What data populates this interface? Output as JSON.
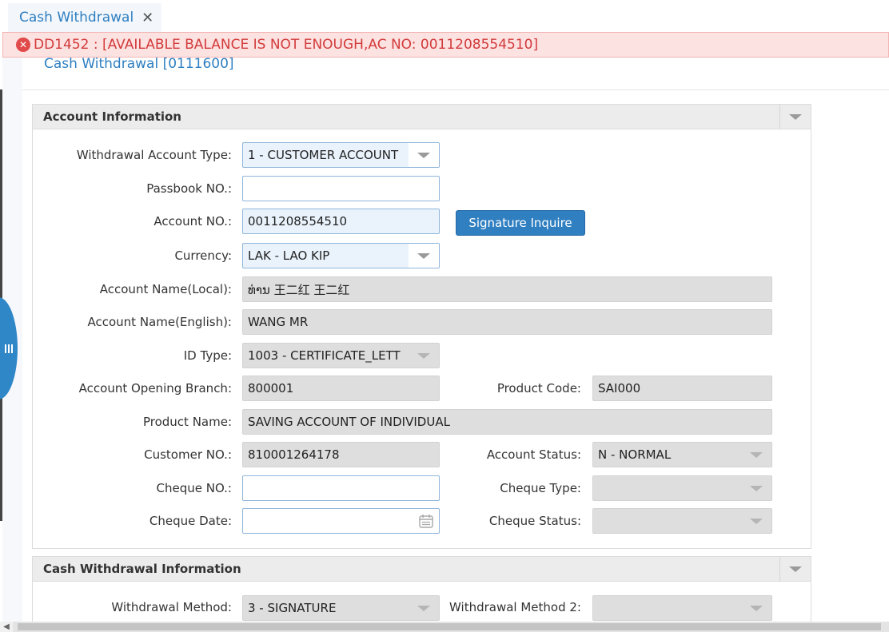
{
  "tab": {
    "label": "Cash Withdrawal",
    "close": "✕"
  },
  "error": {
    "icon": "error-circle-icon",
    "text": "DD1452 : [AVAILABLE BALANCE IS NOT ENOUGH,AC NO: 0011208554510]"
  },
  "page_title": "Cash Withdrawal [0111600]",
  "account_panel": {
    "title": "Account Information",
    "withdrawal_account_type": {
      "label": "Withdrawal Account Type:",
      "value": "1 - CUSTOMER ACCOUNT"
    },
    "passbook_no": {
      "label": "Passbook NO.:",
      "value": ""
    },
    "account_no": {
      "label": "Account NO.:",
      "value": "0011208554510"
    },
    "signature_button": "Signature Inquire",
    "currency": {
      "label": "Currency:",
      "value": "LAK - LAO KIP"
    },
    "account_name_local": {
      "label": "Account Name(Local):",
      "value": "ທ່ານ 王二红 王二红"
    },
    "account_name_english": {
      "label": "Account Name(English):",
      "value": "WANG  MR"
    },
    "id_type": {
      "label": "ID Type:",
      "value": "1003 - CERTIFICATE_LETT"
    },
    "opening_branch": {
      "label": "Account Opening Branch:",
      "value": "800001"
    },
    "product_code": {
      "label": "Product Code:",
      "value": "SAI000"
    },
    "product_name": {
      "label": "Product Name:",
      "value": "SAVING ACCOUNT OF INDIVIDUAL"
    },
    "customer_no": {
      "label": "Customer NO.:",
      "value": "810001264178"
    },
    "account_status": {
      "label": "Account Status:",
      "value": "N - NORMAL"
    },
    "cheque_no": {
      "label": "Cheque NO.:",
      "value": ""
    },
    "cheque_type": {
      "label": "Cheque Type:",
      "value": ""
    },
    "cheque_date": {
      "label": "Cheque Date:",
      "value": ""
    },
    "cheque_status": {
      "label": "Cheque Status:",
      "value": ""
    }
  },
  "withdrawal_panel": {
    "title": "Cash Withdrawal Information",
    "method": {
      "label": "Withdrawal Method:",
      "value": "3 - SIGNATURE"
    },
    "method2": {
      "label": "Withdrawal Method 2:",
      "value": ""
    }
  },
  "colors": {
    "accent": "#2f7fc1",
    "error_bg": "#fde2e2",
    "error_text": "#d23b3b",
    "readonly_bg": "#dedede"
  }
}
